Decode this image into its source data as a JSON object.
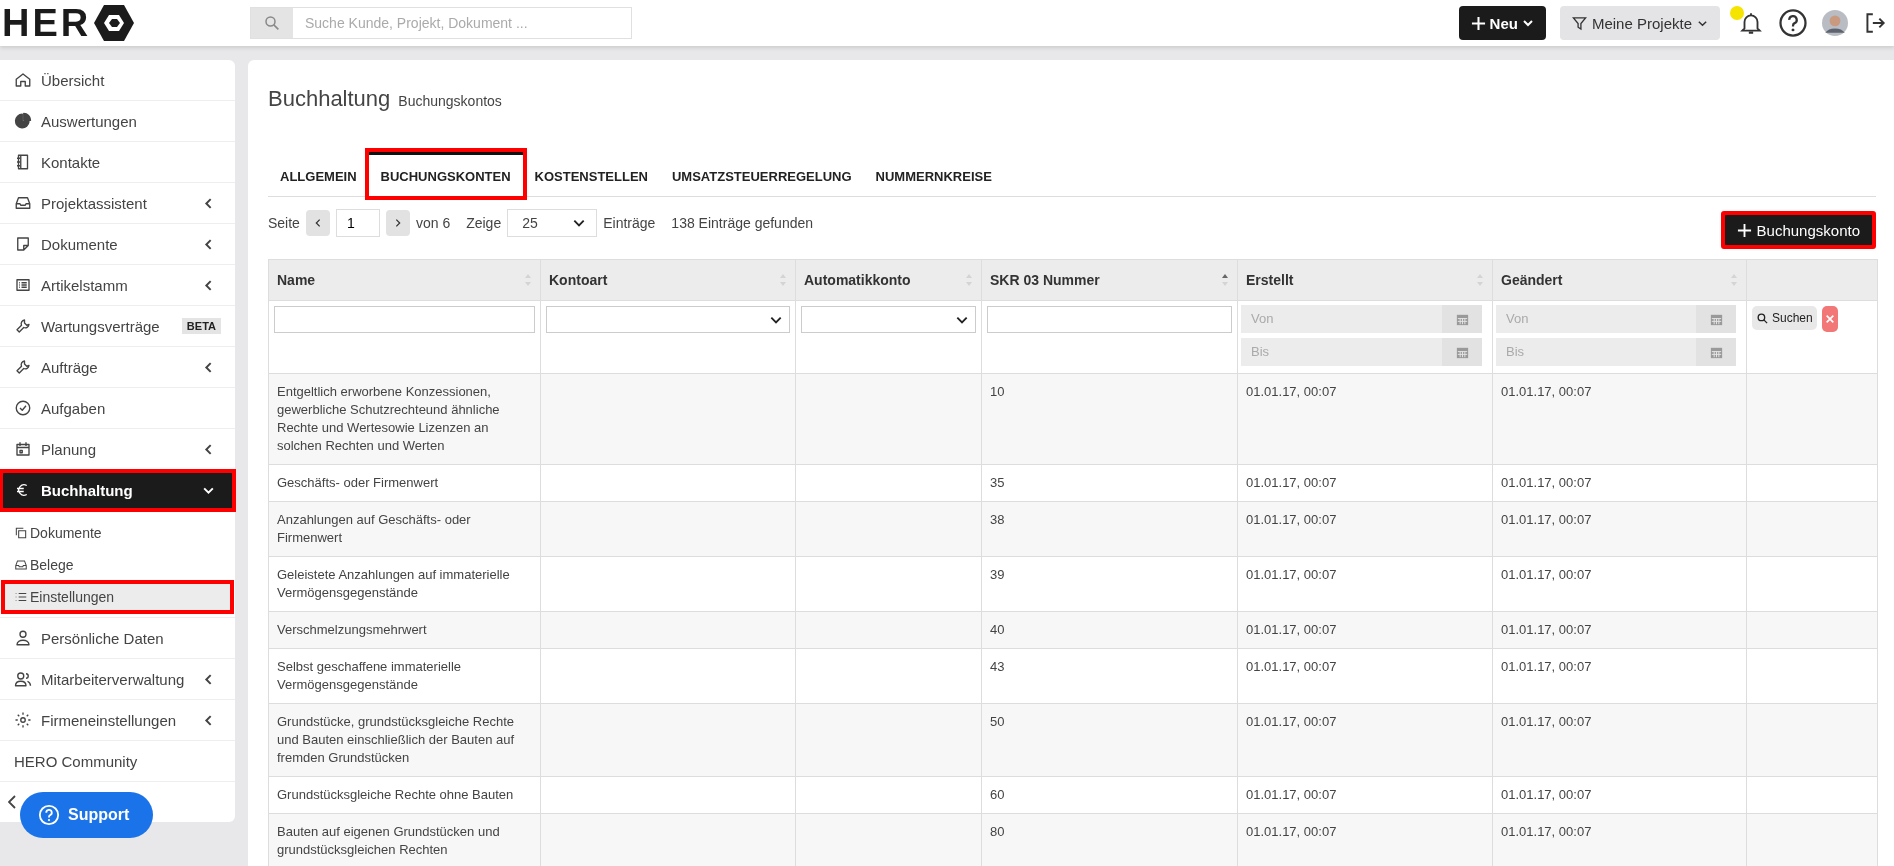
{
  "topbar": {
    "logo": "HER",
    "search": {
      "placeholder": "Suche Kunde, Projekt, Dokument ..."
    },
    "new_button": "Neu",
    "projects_button": "Meine Projekte",
    "notification_dot": true
  },
  "sidebar": {
    "items": [
      {
        "label": "Übersicht",
        "selected": false,
        "highlighted": false
      },
      {
        "label": "Auswertungen",
        "selected": false,
        "highlighted": false
      },
      {
        "label": "Kontakte",
        "selected": false,
        "highlighted": false
      },
      {
        "label": "Projektassistent",
        "expanded": false,
        "selected": false,
        "highlighted": false
      },
      {
        "label": "Dokumente",
        "expanded": false,
        "selected": false,
        "highlighted": false
      },
      {
        "label": "Artikelstamm",
        "expanded": false,
        "selected": false,
        "highlighted": false
      },
      {
        "label": "Wartungsverträge",
        "badge": "BETA",
        "selected": false,
        "highlighted": false
      },
      {
        "label": "Aufträge",
        "expanded": false,
        "selected": false,
        "highlighted": false
      },
      {
        "label": "Aufgaben",
        "selected": false,
        "highlighted": false
      },
      {
        "label": "Planung",
        "expanded": false,
        "selected": false,
        "highlighted": false
      },
      {
        "label": "Buchhaltung",
        "expanded": true,
        "selected": true,
        "highlighted": true,
        "children": [
          {
            "label": "Dokumente",
            "selected": false,
            "highlighted": false
          },
          {
            "label": "Belege",
            "selected": false,
            "highlighted": false
          },
          {
            "label": "Einstellungen",
            "selected": true,
            "highlighted": true
          }
        ]
      },
      {
        "label": "Persönliche Daten",
        "selected": false,
        "highlighted": false
      },
      {
        "label": "Mitarbeiterverwaltung",
        "expanded": false,
        "selected": false,
        "highlighted": false
      },
      {
        "label": "Firmeneinstellungen",
        "expanded": false,
        "selected": false,
        "highlighted": false
      },
      {
        "label": "HERO Community",
        "selected": false,
        "highlighted": false
      }
    ]
  },
  "support_button": "Support",
  "page": {
    "title": "Buchhaltung",
    "subtitle": "Buchungskontos"
  },
  "tabs": [
    {
      "label": "ALLGEMEIN",
      "selected": false,
      "highlighted": false
    },
    {
      "label": "BUCHUNGSKONTEN",
      "selected": true,
      "highlighted": true
    },
    {
      "label": "KOSTENSTELLEN",
      "selected": false,
      "highlighted": false
    },
    {
      "label": "UMSATZSTEUERREGELUNG",
      "selected": false,
      "highlighted": false
    },
    {
      "label": "NUMMERNKREISE",
      "selected": false,
      "highlighted": false
    }
  ],
  "pagination": {
    "page_label": "Seite",
    "page": "1",
    "of": "von 6",
    "show_label": "Zeige",
    "per_page": "25",
    "entries_label": "Einträge",
    "found": "138 Einträge gefunden"
  },
  "add_button": {
    "label": "Buchungskonto",
    "highlighted": true
  },
  "table": {
    "columns": [
      {
        "label": "Name",
        "sorted": false
      },
      {
        "label": "Kontoart",
        "sorted": false
      },
      {
        "label": "Automatikkonto",
        "sorted": false
      },
      {
        "label": "SKR 03 Nummer",
        "sorted": true
      },
      {
        "label": "Erstellt",
        "sorted": false
      },
      {
        "label": "Geändert",
        "sorted": false
      }
    ],
    "date_filters": [
      {
        "from_placeholder": "Von",
        "to_placeholder": "Bis"
      },
      {
        "from_placeholder": "Von",
        "to_placeholder": "Bis"
      }
    ],
    "search_button": "Suchen",
    "rows": [
      {
        "name": "Entgeltlich erworbene Konzessionen, gewerbliche Schutzrechteund ähnliche Rechte und Wertesowie Lizenzen an solchen Rechten und Werten",
        "number": "10",
        "created": "01.01.17, 00:07",
        "changed": "01.01.17, 00:07"
      },
      {
        "name": "Geschäfts- oder Firmenwert",
        "number": "35",
        "created": "01.01.17, 00:07",
        "changed": "01.01.17, 00:07"
      },
      {
        "name": "Anzahlungen auf Geschäfts- oder Firmenwert",
        "number": "38",
        "created": "01.01.17, 00:07",
        "changed": "01.01.17, 00:07"
      },
      {
        "name": "Geleistete Anzahlungen auf immaterielle Vermögensgegenstände",
        "number": "39",
        "created": "01.01.17, 00:07",
        "changed": "01.01.17, 00:07"
      },
      {
        "name": "Verschmelzungsmehrwert",
        "number": "40",
        "created": "01.01.17, 00:07",
        "changed": "01.01.17, 00:07"
      },
      {
        "name": "Selbst geschaffene immaterielle Vermögensgegenstände",
        "number": "43",
        "created": "01.01.17, 00:07",
        "changed": "01.01.17, 00:07"
      },
      {
        "name": "Grundstücke, grundstücksgleiche Rechte und Bauten einschließlich der Bauten auf fremden Grundstücken",
        "number": "50",
        "created": "01.01.17, 00:07",
        "changed": "01.01.17, 00:07"
      },
      {
        "name": "Grundstücksgleiche Rechte ohne Bauten",
        "number": "60",
        "created": "01.01.17, 00:07",
        "changed": "01.01.17, 00:07"
      },
      {
        "name": "Bauten auf eigenen Grundstücken und grundstücksgleichen Rechten",
        "number": "80",
        "created": "01.01.17, 00:07",
        "changed": "01.01.17, 00:07"
      }
    ]
  }
}
